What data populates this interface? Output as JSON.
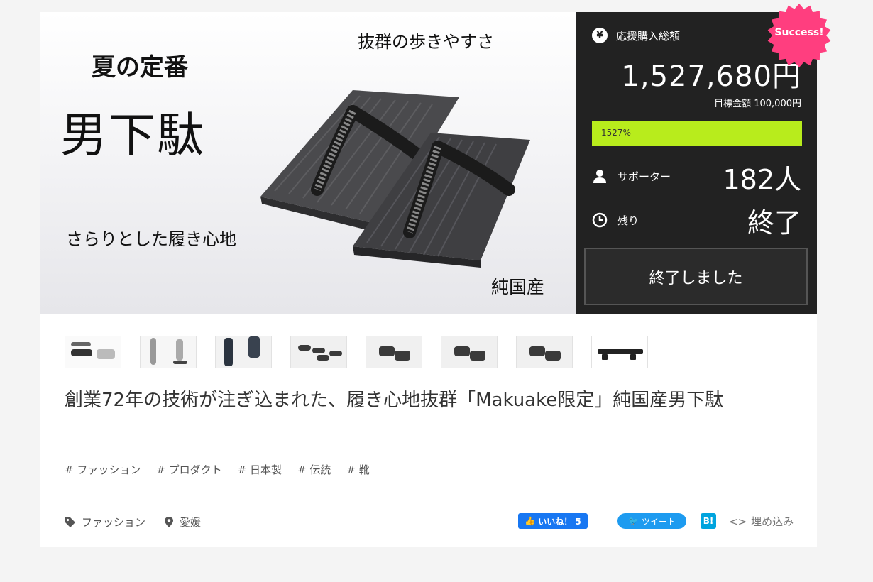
{
  "hero": {
    "line1": "夏の定番",
    "line2": "男下駄",
    "line3": "抜群の歩きやすさ",
    "line4": "さらりとした履き心地",
    "line5": "純国産"
  },
  "stats": {
    "total_label": "応援購入総額",
    "total_amount": "1,527,680円",
    "goal": "目標金額 100,000円",
    "progress_text": "1527%",
    "progress_fraction": 1.0,
    "supporters_label": "サポーター",
    "supporters_value": "182人",
    "remaining_label": "残り",
    "remaining_value": "終了",
    "ended_button": "終了しました",
    "badge": "Success!",
    "accent_color": "#b8ec1c",
    "badge_color": "#ff3e7f"
  },
  "thumbnails": [
    "thumb-1",
    "thumb-2",
    "thumb-3",
    "thumb-4",
    "thumb-5",
    "thumb-6",
    "thumb-7",
    "thumb-8"
  ],
  "title": "創業72年の技術が注ぎ込まれた、履き心地抜群「Makuake限定」純国産男下駄",
  "tags": [
    "# ファッション",
    "# プロダクト",
    "# 日本製",
    "# 伝統",
    "# 靴"
  ],
  "footer": {
    "category": "ファッション",
    "location": "愛媛",
    "like": "いいね！ 5",
    "tweet": "ツイート",
    "hatena": "B!",
    "embed": "埋め込み"
  }
}
